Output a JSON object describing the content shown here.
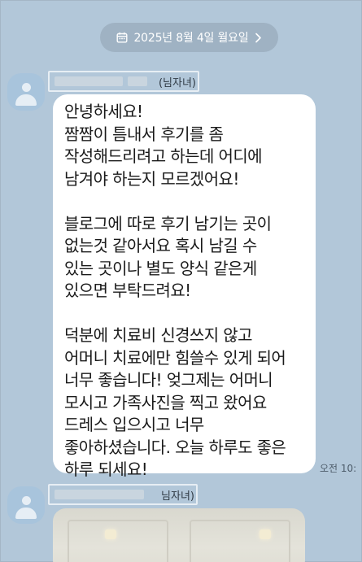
{
  "chat": {
    "date_label": "2025년 8월 4일 월요일",
    "date_icon": "calendar-icon",
    "date_chevron": "chevron-right-icon",
    "messages": [
      {
        "sender_suffix": "님자녀)",
        "sender_open_paren": "(",
        "avatar_icon": "default-profile-icon",
        "lines": [
          "안녕하세요!",
          "짬짬이 틈내서 후기를 좀",
          "작성해드리려고 하는데 어디에",
          "남겨야 하는지 모르겠어요!",
          "",
          "블로그에 따로 후기 남기는 곳이",
          "없는것 같아서요  혹시 남길 수",
          "있는 곳이나 별도 양식 같은게",
          "있으면 부탁드려요!",
          "",
          "덕분에 치료비 신경쓰지 않고",
          "어머니 치료에만 힘쓸수 있게 되어",
          "너무 좋습니다! 엊그제는 어머니",
          "모시고  가족사진을 찍고 왔어요",
          "드레스 입으시고 너무",
          "좋아하셨습니다. 오늘 하루도 좋은",
          "하루 되세요!"
        ],
        "time": "오전 10:"
      },
      {
        "sender_suffix": "님자녀)",
        "avatar_icon": "default-profile-icon",
        "attachment": "photo"
      }
    ]
  },
  "colors": {
    "background": "#b2c7d9",
    "bubble": "#ffffff",
    "date_pill": "#9fb2c3"
  }
}
